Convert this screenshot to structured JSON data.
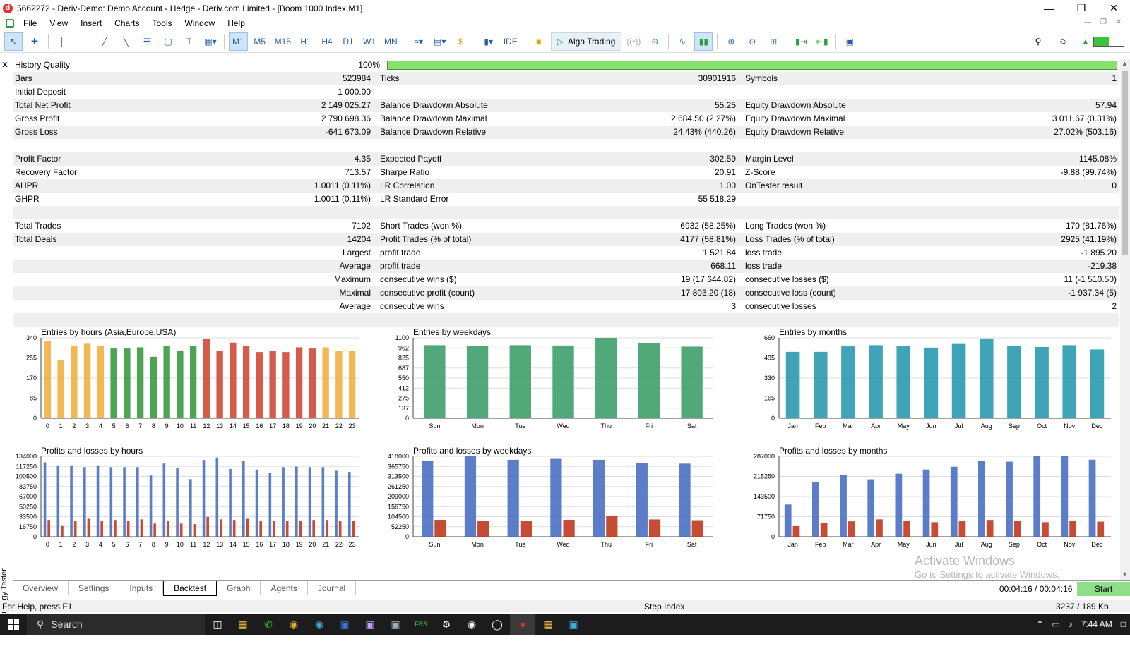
{
  "window": {
    "title": "5662272 - Deriv-Demo: Demo Account - Hedge - Deriv.com Limited - [Boom 1000 Index,M1]",
    "logo_letter": "d"
  },
  "menu": [
    "File",
    "View",
    "Insert",
    "Charts",
    "Tools",
    "Window",
    "Help"
  ],
  "toolbar": {
    "timeframes": [
      "M1",
      "M5",
      "M15",
      "H1",
      "H4",
      "D1",
      "W1",
      "MN"
    ],
    "ide": "IDE",
    "algo": "Algo Trading"
  },
  "side_panel": {
    "title": "Strategy Tester"
  },
  "history_quality": {
    "label": "History Quality",
    "value": "100%",
    "fill_pct": 100
  },
  "stats_rows": [
    {
      "c": [
        "Bars",
        "523984",
        "Ticks",
        "30901916",
        "Symbols",
        "1"
      ]
    },
    {
      "c": [
        "Initial Deposit",
        "1 000.00",
        "",
        "",
        "",
        ""
      ]
    },
    {
      "c": [
        "Total Net Profit",
        "2 149 025.27",
        "Balance Drawdown Absolute",
        "55.25",
        "Equity Drawdown Absolute",
        "57.94"
      ]
    },
    {
      "c": [
        "Gross Profit",
        "2 790 698.36",
        "Balance Drawdown Maximal",
        "2 684.50 (2.27%)",
        "Equity Drawdown Maximal",
        "3 011.67 (0.31%)"
      ]
    },
    {
      "c": [
        "Gross Loss",
        "-641 673.09",
        "Balance Drawdown Relative",
        "24.43% (440.26)",
        "Equity Drawdown Relative",
        "27.02% (503.16)"
      ]
    },
    {
      "c": [
        "",
        "",
        "",
        "",
        "",
        ""
      ]
    },
    {
      "c": [
        "Profit Factor",
        "4.35",
        "Expected Payoff",
        "302.59",
        "Margin Level",
        "1145.08%"
      ]
    },
    {
      "c": [
        "Recovery Factor",
        "713.57",
        "Sharpe Ratio",
        "20.91",
        "Z-Score",
        "-9.88 (99.74%)"
      ]
    },
    {
      "c": [
        "AHPR",
        "1.0011 (0.11%)",
        "LR Correlation",
        "1.00",
        "OnTester result",
        "0"
      ]
    },
    {
      "c": [
        "GHPR",
        "1.0011 (0.11%)",
        "LR Standard Error",
        "55 518.29",
        "",
        ""
      ]
    },
    {
      "c": [
        "",
        "",
        "",
        "",
        "",
        ""
      ]
    },
    {
      "c": [
        "Total Trades",
        "7102",
        "Short Trades (won %)",
        "6932 (58.25%)",
        "Long Trades (won %)",
        "170 (81.76%)"
      ]
    },
    {
      "c": [
        "Total Deals",
        "14204",
        "Profit Trades (% of total)",
        "4177 (58.81%)",
        "Loss Trades (% of total)",
        "2925 (41.19%)"
      ]
    },
    {
      "c": [
        "",
        "Largest",
        "profit trade",
        "1 521.84",
        "loss trade",
        "-1 895.20"
      ]
    },
    {
      "c": [
        "",
        "Average",
        "profit trade",
        "668.11",
        "loss trade",
        "-219.38"
      ]
    },
    {
      "c": [
        "",
        "Maximum",
        "consecutive wins ($)",
        "19 (17 644.82)",
        "consecutive losses ($)",
        "11 (-1 510.50)"
      ]
    },
    {
      "c": [
        "",
        "Maximal",
        "consecutive profit (count)",
        "17 803.20 (18)",
        "consecutive loss (count)",
        "-1 937.34 (5)"
      ]
    },
    {
      "c": [
        "",
        "Average",
        "consecutive wins",
        "3",
        "consecutive losses",
        "2"
      ]
    },
    {
      "c": [
        "",
        "",
        "",
        "",
        "",
        ""
      ]
    }
  ],
  "chart_data": [
    {
      "type": "bar",
      "title": "Entries by hours (Asia,Europe,USA)",
      "categories": [
        "0",
        "1",
        "2",
        "3",
        "4",
        "5",
        "6",
        "7",
        "8",
        "9",
        "10",
        "11",
        "12",
        "13",
        "14",
        "15",
        "16",
        "17",
        "18",
        "19",
        "20",
        "21",
        "22",
        "23"
      ],
      "yticks": [
        "0",
        "85",
        "170",
        "255",
        "340"
      ],
      "ylim": [
        0,
        340
      ],
      "values": [
        325,
        245,
        305,
        315,
        305,
        295,
        295,
        300,
        260,
        305,
        285,
        305,
        335,
        285,
        320,
        305,
        280,
        285,
        280,
        300,
        295,
        300,
        285,
        285
      ],
      "colors": [
        "#f0b040",
        "#f0b040",
        "#f0b040",
        "#f0b040",
        "#f0b040",
        "#3a9a40",
        "#3a9a40",
        "#3a9a40",
        "#3a9a40",
        "#3a9a40",
        "#3a9a40",
        "#3a9a40",
        "#d04a3a",
        "#d04a3a",
        "#d04a3a",
        "#d04a3a",
        "#d04a3a",
        "#d04a3a",
        "#d04a3a",
        "#d04a3a",
        "#d04a3a",
        "#f0b040",
        "#f0b040",
        "#f0b040"
      ]
    },
    {
      "type": "bar",
      "title": "Entries by weekdays",
      "categories": [
        "Sun",
        "Mon",
        "Tue",
        "Wed",
        "Thu",
        "Fri",
        "Sat"
      ],
      "yticks": [
        "0",
        "137",
        "275",
        "412",
        "550",
        "687",
        "825",
        "962",
        "1100"
      ],
      "ylim": [
        0,
        1100
      ],
      "values": [
        1000,
        990,
        1000,
        995,
        1100,
        1030,
        980
      ],
      "colors": [
        "#3ea06a"
      ]
    },
    {
      "type": "bar",
      "title": "Entries by months",
      "categories": [
        "Jan",
        "Feb",
        "Mar",
        "Apr",
        "May",
        "Jun",
        "Jul",
        "Aug",
        "Sep",
        "Oct",
        "Nov",
        "Dec"
      ],
      "yticks": [
        "0",
        "165",
        "330",
        "495",
        "660"
      ],
      "ylim": [
        0,
        660
      ],
      "values": [
        545,
        545,
        590,
        600,
        595,
        580,
        610,
        655,
        595,
        585,
        600,
        565
      ],
      "colors": [
        "#2a9ab0"
      ]
    },
    {
      "type": "bar",
      "title": "Profits and losses by hours",
      "categories": [
        "0",
        "1",
        "2",
        "3",
        "4",
        "5",
        "6",
        "7",
        "8",
        "9",
        "10",
        "11",
        "12",
        "13",
        "14",
        "15",
        "16",
        "17",
        "18",
        "19",
        "20",
        "21",
        "22",
        "23"
      ],
      "yticks": [
        "0",
        "16750",
        "33500",
        "50250",
        "67000",
        "83750",
        "100500",
        "117250",
        "134000"
      ],
      "ylim": [
        0,
        134000
      ],
      "series": [
        {
          "name": "Profits",
          "values": [
            124000,
            119000,
            119000,
            116000,
            119000,
            116000,
            116000,
            116000,
            102000,
            122000,
            114000,
            96000,
            128000,
            132000,
            113000,
            126000,
            112000,
            106000,
            116000,
            117000,
            116000,
            116000,
            110000,
            108000
          ]
        },
        {
          "name": "Losses",
          "values": [
            28000,
            18000,
            26000,
            30000,
            27000,
            28000,
            26000,
            29000,
            22000,
            27000,
            22000,
            21000,
            33000,
            29000,
            28000,
            30000,
            27000,
            26000,
            27000,
            26000,
            28000,
            28000,
            27000,
            27000
          ]
        }
      ],
      "colors": [
        "#4a6fc2",
        "#c0391e"
      ]
    },
    {
      "type": "bar",
      "title": "Profits and losses by weekdays",
      "categories": [
        "Sun",
        "Mon",
        "Tue",
        "Wed",
        "Thu",
        "Fri",
        "Sat"
      ],
      "yticks": [
        "0",
        "52250",
        "104500",
        "156750",
        "209000",
        "261250",
        "313500",
        "365750",
        "418000"
      ],
      "ylim": [
        0,
        418000
      ],
      "series": [
        {
          "name": "Profits",
          "values": [
            395000,
            418000,
            400000,
            405000,
            400000,
            385000,
            380000
          ]
        },
        {
          "name": "Losses",
          "values": [
            88000,
            84000,
            82000,
            88000,
            108000,
            90000,
            86000
          ]
        }
      ],
      "colors": [
        "#4a6fc2",
        "#c0391e"
      ]
    },
    {
      "type": "bar",
      "title": "Profits and losses by months",
      "categories": [
        "Jan",
        "Feb",
        "Mar",
        "Apr",
        "May",
        "Jun",
        "Jul",
        "Aug",
        "Sep",
        "Oct",
        "Nov",
        "Dec"
      ],
      "yticks": [
        "0",
        "71750",
        "143500",
        "215250",
        "287000"
      ],
      "ylim": [
        0,
        287000
      ],
      "series": [
        {
          "name": "Profits",
          "values": [
            115000,
            195000,
            220000,
            205000,
            225000,
            240000,
            250000,
            270000,
            268000,
            287000,
            287000,
            275000
          ]
        },
        {
          "name": "Losses",
          "values": [
            38000,
            48000,
            55000,
            62000,
            58000,
            52000,
            58000,
            60000,
            56000,
            52000,
            58000,
            54000
          ]
        }
      ],
      "colors": [
        "#4a6fc2",
        "#c0391e"
      ]
    }
  ],
  "tabs": [
    "Overview",
    "Settings",
    "Inputs",
    "Backtest",
    "Graph",
    "Agents",
    "Journal"
  ],
  "active_tab": "Backtest",
  "timer": "00:04:16 / 00:04:16",
  "start_label": "Start",
  "status": {
    "help": "For Help, press F1",
    "profile": "Step Index",
    "traffic": "3237 / 189 Kb"
  },
  "watermark": {
    "line1": "Activate Windows",
    "line2": "Go to Settings to activate Windows."
  },
  "taskbar": {
    "search": "Search",
    "time": "7:44 AM"
  }
}
